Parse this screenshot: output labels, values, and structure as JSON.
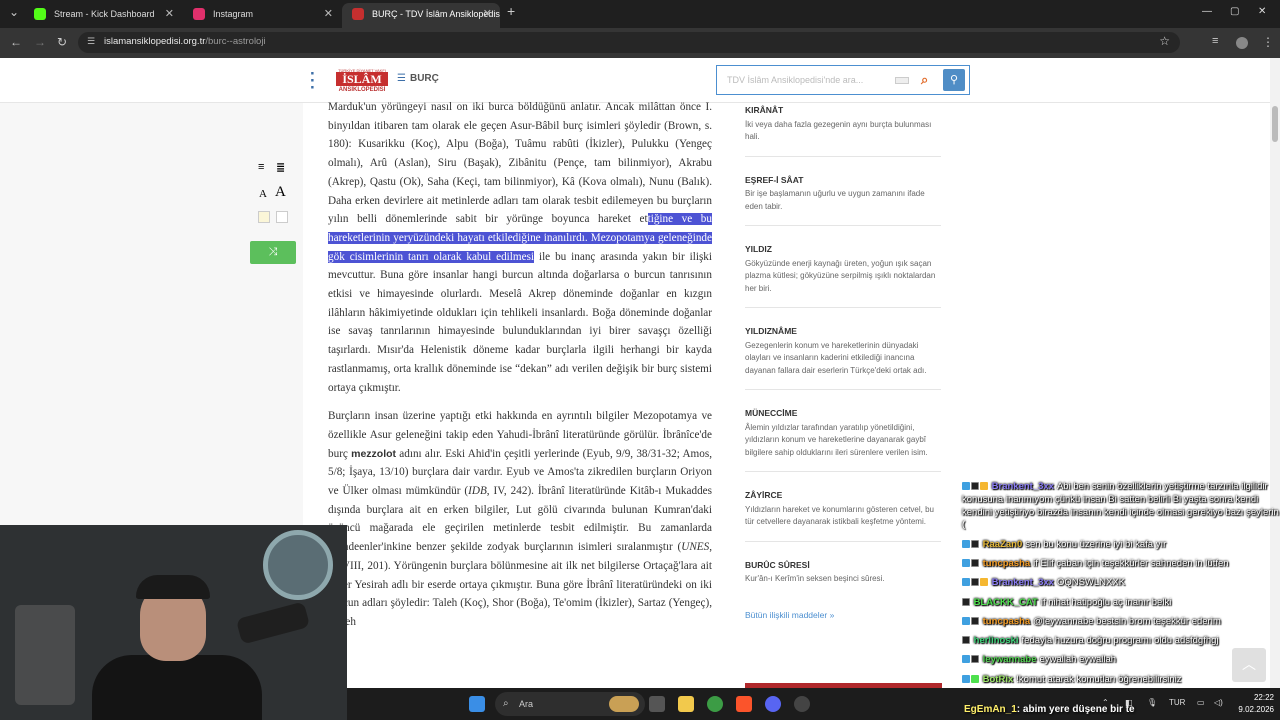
{
  "browser": {
    "tabs": [
      {
        "title": "Stream - Kick Dashboard",
        "favicon_color": "#53fc18",
        "active": false
      },
      {
        "title": "Instagram",
        "favicon_color": "#e1306c",
        "active": false
      },
      {
        "title": "BURÇ - TDV İslâm Ansiklopedisi",
        "favicon_color": "#c62f2f",
        "active": true
      }
    ],
    "url_host": "islamansiklopedisi.org.tr",
    "url_path": "/burc--astroloji"
  },
  "site": {
    "logo_top": "TÜRKİYE DİYANET VAKFI",
    "logo_main": "İSLÂM",
    "logo_bottom": "ANSİKLOPEDİSİ",
    "nav_title": "BURÇ",
    "search_placeholder": "TDV İslâm Ansiklopedisi'nde ara..."
  },
  "article": {
    "p1_a": "Marduk'un yörüngeyi nasıl on iki burca böldüğünü anlatır. Ancak milâttan önce I. binyıldan itibaren tam olarak ele geçen Asur-Bâbil burç isimleri şöyledir (Brown, s. 180): Kusarikku (Koç), Alpu (Boğa), Tuâmu rabûti (İkizler), Pulukku (Yengeç olmalı), Arû (Aslan), Siru (Başak), Zibânitu (Pençe, tam bilinmiyor), Akrabu (Akrep), Qastu (Ok), Saha (Keçi, tam bilinmiyor), Kâ (Kova olmalı), Nunu (Balık). Daha erken devirlere ait metinlerde adları tam olarak tesbit edilemeyen bu burçların yılın belli dönemlerinde sabit bir yörünge boyunca hareket et",
    "p1_hl": "tiğine ve bu hareketlerinin yeryüzündeki hayatı etkilediğine inanılırdı. Mezopotamya geleneğinde gök cisimlerinin tanrı olarak kabul edilmesi",
    "p1_b": " ile bu inanç arasında yakın bir ilişki mevcuttur. Buna göre insanlar hangi burcun altında doğarlarsa o burcun tanrısının etkisi ve himayesinde olurlardı. Meselâ Akrep döneminde doğanlar en kızgın ilâhların hâkimiyetinde oldukları için tehlikeli insanlardı. Boğa döneminde doğanlar ise savaş tanrılarının himayesinde bulunduklarından iyi birer savaşçı özelliği taşırlardı. Mısır'da Helenistik döneme kadar burçlarla ilgili herhangi bir kayda rastlanmamış, orta krallık döneminde ise “dekan” adı verilen değişik bir burç sistemi ortaya çıkmıştır.",
    "p2_a": "Burçların insan üzerine yaptığı etki hakkında en ayrıntılı bilgiler Mezopotamya ve özellikle Asur geleneğini takip eden Yahudi-İbrânî literatüründe görülür. İbrânîce'de burç ",
    "p2_term": "mezzolot",
    "p2_b": " adını alır. Eski Ahid'in çeşitli yerlerinde (Eyub, 9/9, 38/31-32; Amos, 5/8; İşaya, 13/10) burçlara dair vardır. Eyub ve Amos'ta zikredilen burçların Oriyon ve Ülker olması mümkündür (",
    "p2_idb": "IDB",
    "p2_c": ", IV, 242). İbrânî literatüründe Kitâb-ı Mukaddes dışında burçlara ait en erken bilgiler, Lut gölü civarında bulunan Kumran'daki üçüncü mağarada ele geçirilen metinlerde tesbit edilmiştir. Bu zamanlarda Mandeenler'inkine benzer şekilde zodyak burçlarının isimleri sıralanmıştır (",
    "p2_unes": "UNES",
    "p2_d": ", XLVIII, 201). Yörüngenin burçlara bölünmesine ait ilk net bilgilerse Ortaçağ'lara ait Sefer Yesirah adlı bir eserde ortaya çıkmıştır. Buna göre İbrânî literatüründeki on iki burcun adları şöyledir: Taleh (Koç), Shor (Boğa), Te'omim (İkizler), Sartaz (Yengeç), Aryeh"
  },
  "sidebar": {
    "terms": [
      {
        "title": "KIRÂNÂT",
        "desc": "İki veya daha fazla gezegenin aynı burçta bulunması hali."
      },
      {
        "title": "EŞREF-İ SÂAT",
        "desc": "Bir işe başlamanın uğurlu ve uygun zamanını ifade eden tabir."
      },
      {
        "title": "YILDIZ",
        "desc": "Gökyüzünde enerji kaynağı üreten, yoğun ışık saçan plazma kütlesi; gökyüzüne serpilmiş ışıklı noktalardan her biri."
      },
      {
        "title": "YILDIZNÂME",
        "desc": "Gezegenlerin konum ve hareketlerinin dünyadaki olayları ve insanların kaderini etkilediği inancına dayanan fallara dair eserlerin Türkçe'deki ortak adı."
      },
      {
        "title": "MÜNECCİME",
        "desc": "Âlemin yıldızlar tarafından yaratılıp yönetildiğini, yıldızların konum ve hareketlerine dayanarak gaybî bilgilere sahip olduklarını ileri sürenlere verilen isim."
      },
      {
        "title": "ZÂYİRCE",
        "desc": "Yıldızların hareket ve konumlarını gösteren cetvel, bu tür cetvellere dayanarak istikbali keşfetme yöntemi."
      },
      {
        "title": "BURÛC SÛRESİ",
        "desc": "Kur'ân-ı Kerîm'in seksen beşinci sûresi."
      }
    ],
    "all_link": "Bütün ilişkili maddeler »"
  },
  "chat": [
    {
      "user": "Brankent_3xx",
      "ucolor": "#8a7cf2",
      "text": "Abi ben senin özelliklerin yetiştirme tarzınla ilgilidir konusuna inanmıyom çünkü insan Bi satten belirli Bi yaşta sonra kendi kendini yetiştiriyo birazda insanın kendi içinde olmasi gerekiyo bazı şeylerin ("
    },
    {
      "user": "RaaZan0",
      "ucolor": "#e6b93a",
      "text": "sen bu konu üzerine iyi bi kafa yır"
    },
    {
      "user": "tuncpasha",
      "ucolor": "#f39c26",
      "text": "if Elif çaban için teşekkürler sahneden in lütfen"
    },
    {
      "user": "Brankent_3xx",
      "ucolor": "#8a7cf2",
      "text": "OQNSWLNXXK"
    },
    {
      "user": "BLACKK_CAT",
      "ucolor": "#4ee04e",
      "text": "if nihat hatipoğlu aç inanır belki"
    },
    {
      "user": "tuncpasha",
      "ucolor": "#f39c26",
      "text": "@leywannabe bestsin brom teşekkür ederim"
    },
    {
      "user": "herlinoski",
      "ucolor": "#3fd47a",
      "text": "fedayla huzura doğru programı oldu adsfdgfhgj"
    },
    {
      "user": "leywannabe",
      "ucolor": "#54d354",
      "text": "eywallah eywallah"
    },
    {
      "user": "BotRix",
      "ucolor": "#9ee66a",
      "text": "!komut atarak komutları öğrenebilirsiniz"
    }
  ],
  "overlay": {
    "user": "EgEmAn_1",
    "text": ": abim yere düşene bir te"
  },
  "taskbar": {
    "search_label": "Ara",
    "lang": "TUR",
    "time": "22:22",
    "date": "9.02.2026"
  }
}
